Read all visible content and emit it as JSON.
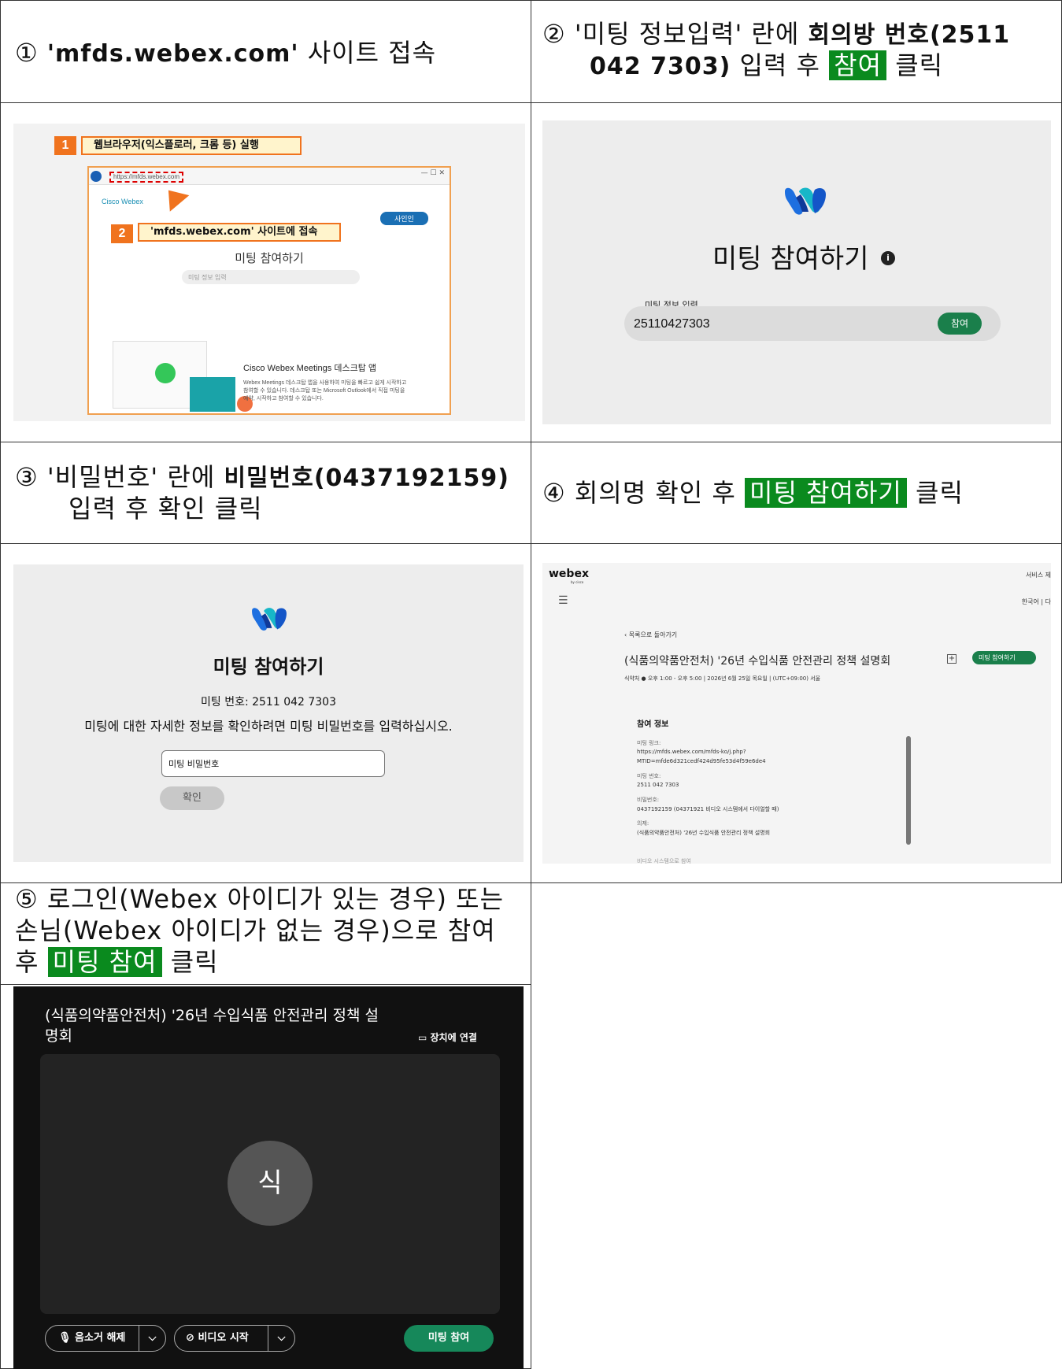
{
  "steps": [
    {
      "number": "①",
      "parts": [
        {
          "text": "'mfds.webex.com'",
          "bold": true
        },
        {
          "text": " 사이트 접속"
        }
      ]
    },
    {
      "number": "②",
      "line1_a": "'미팅 정보입력' 란에 ",
      "line1_b": "회의방 번호(2511",
      "line2_a": "042 7303)",
      "line2_b": " 입력 후 ",
      "line2_hl": "참여",
      "line2_c": " 클릭"
    },
    {
      "number": "③",
      "line1_a": "'비밀번호' 란에 ",
      "line1_b": "비밀번호(0437192159)",
      "line2": "입력 후 확인 클릭"
    },
    {
      "number": "④",
      "a": "회의명 확인 후 ",
      "hl": "미팅 참여하기",
      "b": " 클릭"
    },
    {
      "number": "⑤",
      "line1": "로그인(Webex 아이디가 있는 경우) 또는",
      "line2": "손님(Webex 아이디가 없는 경우)으로 참여",
      "line3_a": "후 ",
      "line3_hl": "미팅 참여",
      "line3_b": " 클릭"
    }
  ],
  "shot1": {
    "badge1": "1",
    "callout1": "웹브라우저(익스플로러, 크롬 등) 실행",
    "badge2": "2",
    "callout2": "'mfds.webex.com' 사이트에 접속",
    "url": "https://mfds.webex.com",
    "brand": "Cisco Webex",
    "page_title": "미팅 참여하기",
    "input_ph": "미팅 정보 입력",
    "signin": "사인인",
    "app_title": "Cisco Webex Meetings 데스크탑 앱",
    "app_desc1": "Webex Meetings 데스크탑 앱을 사용하여 미팅을 빠르고 쉽게 시작하고",
    "app_desc2": "참여할 수 있습니다. 데스크탑 또는 Microsoft Outlook에서 직접 미팅을",
    "app_desc3": "예약, 시작하고 참여할 수 있습니다."
  },
  "shot2": {
    "title": "미팅 참여하기",
    "info": "i",
    "label": "미팅 정보 입력",
    "value": "25110427303",
    "button": "참여"
  },
  "shot3": {
    "title": "미팅 참여하기",
    "meeting_no": "미팅 번호: 2511 042 7303",
    "desc": "미팅에 대한 자세한 정보를 확인하려면 미팅 비밀번호를 입력하십시오.",
    "pwd_ph": "미팅 비밀번호",
    "ok": "확인"
  },
  "shot4": {
    "logo": "webex",
    "logo_sub": "by cisco",
    "service": "서비스 제",
    "lang": "한국어 | 다",
    "back": "‹ 목록으로 돌아가기",
    "title": "(식품의약품안전처) '26년 수입식품 안전관리 정책 설명회",
    "join": "미팅 참여하기",
    "meta": "식약처 ● 오후 1:00 - 오후 5:00 | 2026년 6월 25일 목요일 | (UTC+09:00) 서울",
    "section": "참여 정보",
    "link_label": "미팅 링크:",
    "link1": "https://mfds.webex.com/mfds-ko/j.php?",
    "link2": "MTID=mfde6d321cedf424d95fe53d4f59e6de4",
    "no_label": "미팅 번호:",
    "no": "2511 042 7303",
    "pwd_label": "비밀번호:",
    "pwd": "0437192159 (04371921 비디오 시스템에서 다이얼할 때)",
    "agenda_label": "의제:",
    "agenda": "(식품의약품안전처) '26년 수입식품 안전관리 정책 설명회",
    "cut": "비디오 시스템으로 참여"
  },
  "shot5": {
    "title1": "(식품의약품안전처) '26년 수입식품 안전관리 정책 설",
    "title2": "명회",
    "device": "장치에 연결",
    "avatar": "식",
    "mute": "음소거 해제",
    "video": "비디오 시작",
    "join": "미팅 참여"
  }
}
